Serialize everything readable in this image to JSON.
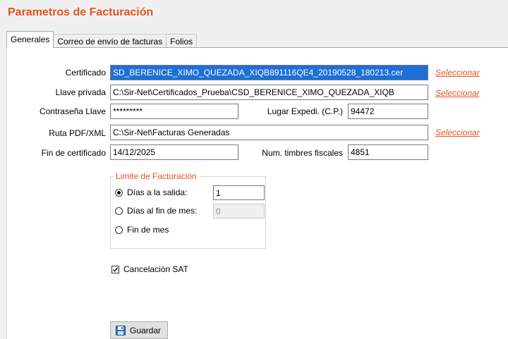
{
  "window": {
    "title": "Parametros de Facturación"
  },
  "tabs": [
    {
      "label": "Generales",
      "active": true
    },
    {
      "label": "Correo de envío de facturas",
      "active": false
    },
    {
      "label": "Folios",
      "active": false
    }
  ],
  "form": {
    "certificado": {
      "label": "Certificado",
      "value": "SD_BERENICE_XIMO_QUEZADA_XIQB891116QE4_20190528_180213.cer",
      "action": "Seleccionar"
    },
    "llave_privada": {
      "label": "Llave privada",
      "value": "C:\\Sir-Net\\Certificados_Prueba\\CSD_BERENICE_XIMO_QUEZADA_XIQB",
      "action": "Seleccionar"
    },
    "contrasena_llave": {
      "label": "Contraseña Llave",
      "value": "*********"
    },
    "lugar_expedicion": {
      "label": "Lugar Expedi. (C.P.)",
      "value": "94472"
    },
    "ruta_pdf_xml": {
      "label": "Ruta PDF/XML",
      "value": "C:\\Sir-Net\\Facturas Generadas",
      "action": "Seleccionar"
    },
    "fin_certificado": {
      "label": "Fin de certificado",
      "value": "14/12/2025"
    },
    "num_timbres": {
      "label": "Num. timbres fiscales",
      "value": "4851"
    }
  },
  "limite": {
    "title": "Limite de Facturación",
    "options": [
      {
        "label": "Días a la salida:",
        "value": "1",
        "selected": true
      },
      {
        "label": "Días al fin de mes:",
        "value": "0",
        "selected": false
      },
      {
        "label": "Fin de mes",
        "selected": false
      }
    ]
  },
  "cancelacion": {
    "label": "Cancelación SAT",
    "checked": true
  },
  "buttons": {
    "save_label": "Guardar"
  },
  "colors": {
    "accent": "#e8531f",
    "selection": "#1e6fd6"
  },
  "icons": {
    "save": "floppy-disk-icon"
  }
}
